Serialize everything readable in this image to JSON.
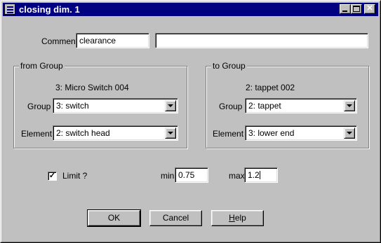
{
  "window": {
    "title": "closing dim. 1",
    "close_glyph": "✕"
  },
  "comment": {
    "label": "Comment",
    "value": "clearance",
    "extra_value": ""
  },
  "from_group": {
    "title": "from Group",
    "object_name": "3: Micro Switch 004",
    "group_label": "Group",
    "group_value": "3: switch",
    "element_label": "Element",
    "element_value": "2: switch head"
  },
  "to_group": {
    "title": "to Group",
    "object_name": "2: tappet 002",
    "group_label": "Group",
    "group_value": "2: tappet",
    "element_label": "Element",
    "element_value": "3: lower end"
  },
  "limit": {
    "label": "Limit ?",
    "checked": true,
    "check_glyph": "✓",
    "min_label": "min",
    "min_value": "0.75",
    "max_label": "max",
    "max_value": "1.2"
  },
  "buttons": {
    "ok": "OK",
    "cancel": "Cancel",
    "help_mnemonic": "H",
    "help_rest": "elp"
  }
}
